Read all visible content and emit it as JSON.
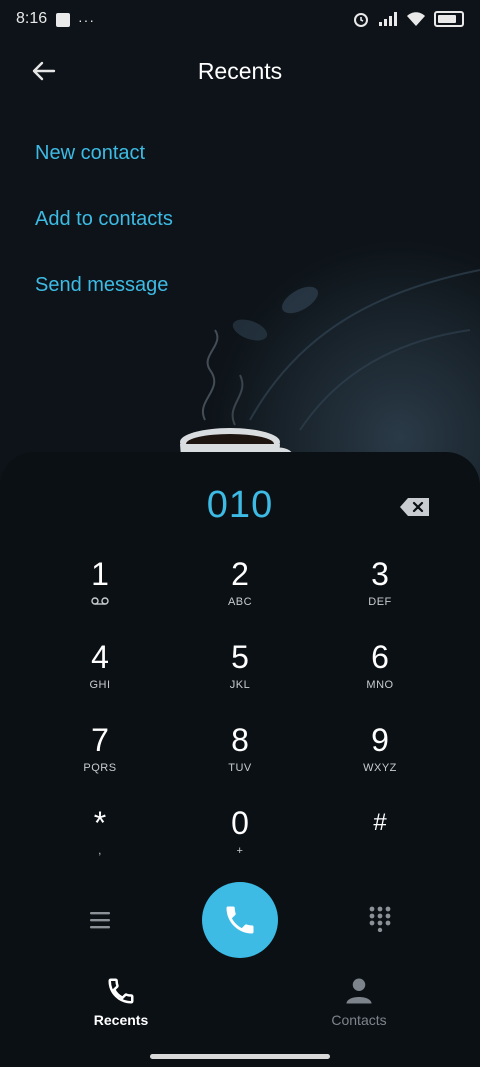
{
  "status_bar": {
    "time": "8:16",
    "left_icons": [
      "notification-square-icon",
      "more-dots-icon"
    ],
    "right_icons": [
      "alarm-icon",
      "signal-icon",
      "wifi-icon",
      "battery-icon"
    ]
  },
  "header": {
    "title": "Recents",
    "back_icon": "back-arrow-icon"
  },
  "actions": [
    {
      "label": "New contact"
    },
    {
      "label": "Add to contacts"
    },
    {
      "label": "Send message"
    }
  ],
  "dialer": {
    "number": "010",
    "backspace_icon": "backspace-icon",
    "keys": [
      {
        "digit": "1",
        "sub": "",
        "sub_icon": "voicemail-icon"
      },
      {
        "digit": "2",
        "sub": "ABC"
      },
      {
        "digit": "3",
        "sub": "DEF"
      },
      {
        "digit": "4",
        "sub": "GHI"
      },
      {
        "digit": "5",
        "sub": "JKL"
      },
      {
        "digit": "6",
        "sub": "MNO"
      },
      {
        "digit": "7",
        "sub": "PQRS"
      },
      {
        "digit": "8",
        "sub": "TUV"
      },
      {
        "digit": "9",
        "sub": "WXYZ"
      },
      {
        "digit": "*",
        "sub": ","
      },
      {
        "digit": "0",
        "sub": "+"
      },
      {
        "digit": "#",
        "sub": ""
      }
    ],
    "menu_icon": "menu-icon",
    "call_icon": "phone-icon",
    "keypad_toggle_icon": "keypad-grid-icon"
  },
  "tabs": [
    {
      "label": "Recents",
      "icon": "phone-icon",
      "active": true
    },
    {
      "label": "Contacts",
      "icon": "person-icon",
      "active": false
    }
  ],
  "colors": {
    "accent": "#3dbbe4",
    "background": "#0d1318",
    "sheet": "#0b1015"
  }
}
